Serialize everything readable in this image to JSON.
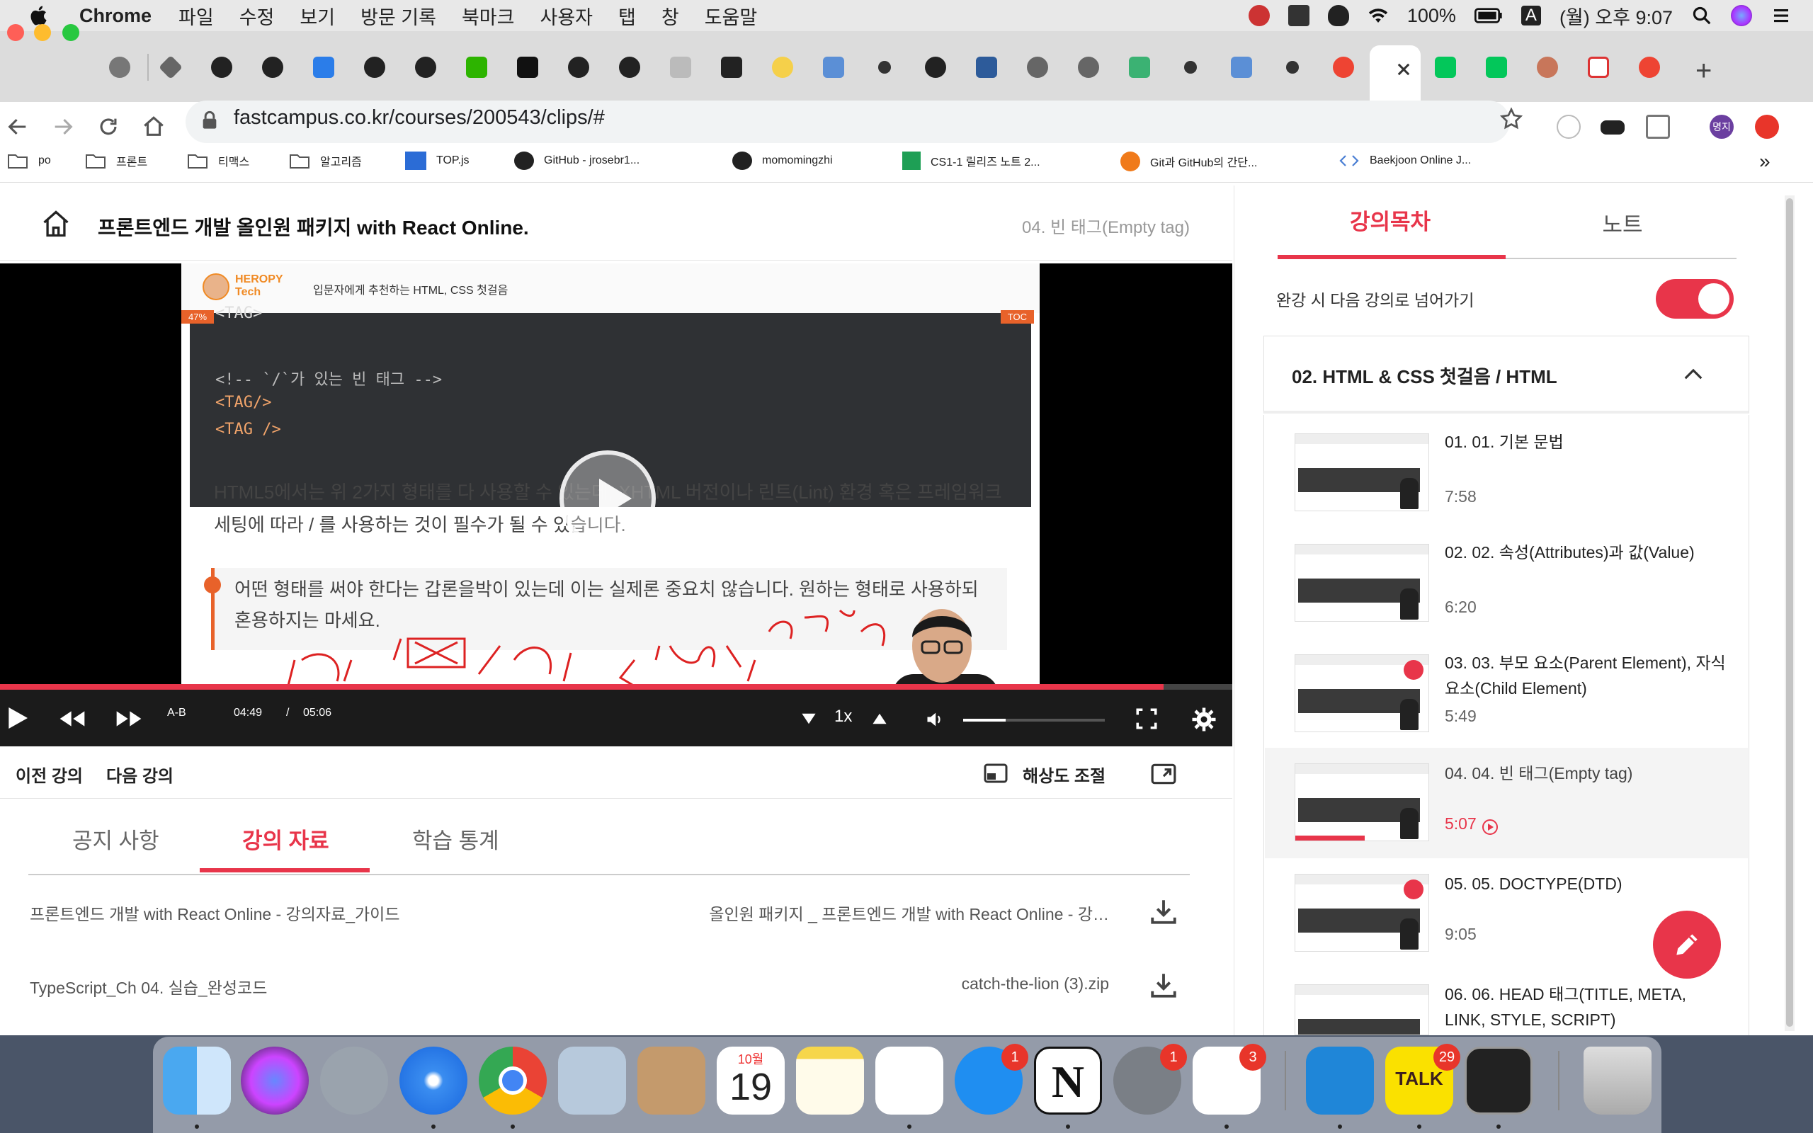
{
  "menubar": {
    "app_name": "Chrome",
    "items": [
      "파일",
      "수정",
      "보기",
      "방문 기록",
      "북마크",
      "사용자",
      "탭",
      "창",
      "도움말"
    ],
    "battery": "100%",
    "input_source": "A",
    "clock": "(월) 오후 9:07"
  },
  "browser": {
    "url": "fastcampus.co.kr/courses/200543/clips/#",
    "profile_label": "명지",
    "bookmarks": [
      {
        "label": "po",
        "icon": "folder-icon"
      },
      {
        "label": "프론트",
        "icon": "folder-icon"
      },
      {
        "label": "티맥스",
        "icon": "folder-icon"
      },
      {
        "label": "알고리즘",
        "icon": "folder-icon"
      },
      {
        "label": "TOP.js",
        "icon": "app-icon"
      },
      {
        "label": "GitHub - jrosebr1...",
        "icon": "github-icon"
      },
      {
        "label": "momomingzhi",
        "icon": "github-icon"
      },
      {
        "label": "CS1-1 릴리즈 노트 2...",
        "icon": "sheets-icon"
      },
      {
        "label": "Git과 GitHub의 간단...",
        "icon": "orange-dot-icon"
      },
      {
        "label": "Baekjoon Online J...",
        "icon": "code-icon"
      }
    ],
    "bookmarks_overflow": "»"
  },
  "course": {
    "title": "프론트엔드 개발 올인원 패키지 with React Online.",
    "current_clip": "04. 빈 태그(Empty tag)"
  },
  "slide": {
    "brand_line1": "HEROPY",
    "brand_line2": "Tech",
    "subtitle": "입문자에게 추천하는 HTML, CSS 첫걸음",
    "badge_left": "47%",
    "badge_right": "TOC",
    "code_lines": [
      "<TAG>",
      "<!-- `/`가 있는 빈 태그 -->",
      "<TAG/>",
      "<TAG />"
    ],
    "paragraph": "HTML5에서는 위 2가지 형태를 다 사용할 수 있는데, XHTML 버전이나 린트(Lint) 환경 혹은 프레임워크 세팅에 따라 / 를 사용하는 것이 필수가 될 수 있습니다.",
    "quote": "어떤 형태를 써야 한다는 갑론을박이 있는데 이는 실제론 중요치 않습니다. 원하는 형태로 사용하되 혼용하지는 마세요."
  },
  "player": {
    "current_time": "04:49",
    "separator": "/",
    "duration": "05:06",
    "ab_label": "A-B",
    "speed": "1x",
    "progress_pct": 94.4,
    "volume_pct": 30
  },
  "lecture_nav": {
    "prev": "이전 강의",
    "next": "다음 강의",
    "resolution": "해상도 조절"
  },
  "bottom_tabs": [
    {
      "label": "공지 사항",
      "active": false
    },
    {
      "label": "강의 자료",
      "active": true
    },
    {
      "label": "학습 통계",
      "active": false
    }
  ],
  "files": [
    {
      "left": "프론트엔드 개발 with React Online - 강의자료_가이드",
      "right": "올인원 패키지 _ 프론트엔드 개발 with React Online - 강…"
    },
    {
      "left": "TypeScript_Ch 04. 실습_완성코드",
      "right": "catch-the-lion (3).zip"
    }
  ],
  "sidebar": {
    "tab_contents": "강의목차",
    "tab_notes": "노트",
    "autoplay_label": "완강 시 다음 강의로 넘어가기",
    "autoplay_on": true,
    "section_title": "02. HTML & CSS 첫걸음 / HTML",
    "clips": [
      {
        "title": "01. 01. 기본 문법",
        "duration": "7:58",
        "completed": false,
        "active": false
      },
      {
        "title": "02. 02. 속성(Attributes)과 값(Value)",
        "duration": "6:20",
        "completed": false,
        "active": false
      },
      {
        "title": "03. 03. 부모 요소(Parent Element), 자식 요소(Child Element)",
        "duration": "5:49",
        "completed": true,
        "active": false
      },
      {
        "title": "04. 04. 빈 태그(Empty tag)",
        "duration": "5:07",
        "completed": false,
        "active": true,
        "progress_pct": 52
      },
      {
        "title": "05. 05. DOCTYPE(DTD)",
        "duration": "9:05",
        "completed": true,
        "active": false
      },
      {
        "title": "06. 06. HEAD 태그(TITLE, META, LINK, STYLE, SCRIPT)",
        "duration": "",
        "completed": false,
        "active": false
      }
    ]
  },
  "dock": {
    "calendar_month": "10월",
    "calendar_day": "19",
    "badges": {
      "app_store": "1",
      "system_preferences": "1",
      "slack": "3",
      "kakaotalk": "29"
    },
    "kakaotalk_label": "TALK",
    "notion_label": "N"
  },
  "colors": {
    "accent": "#e8354a",
    "slide_orange": "#e8622a",
    "code_bg": "#2f3134"
  }
}
